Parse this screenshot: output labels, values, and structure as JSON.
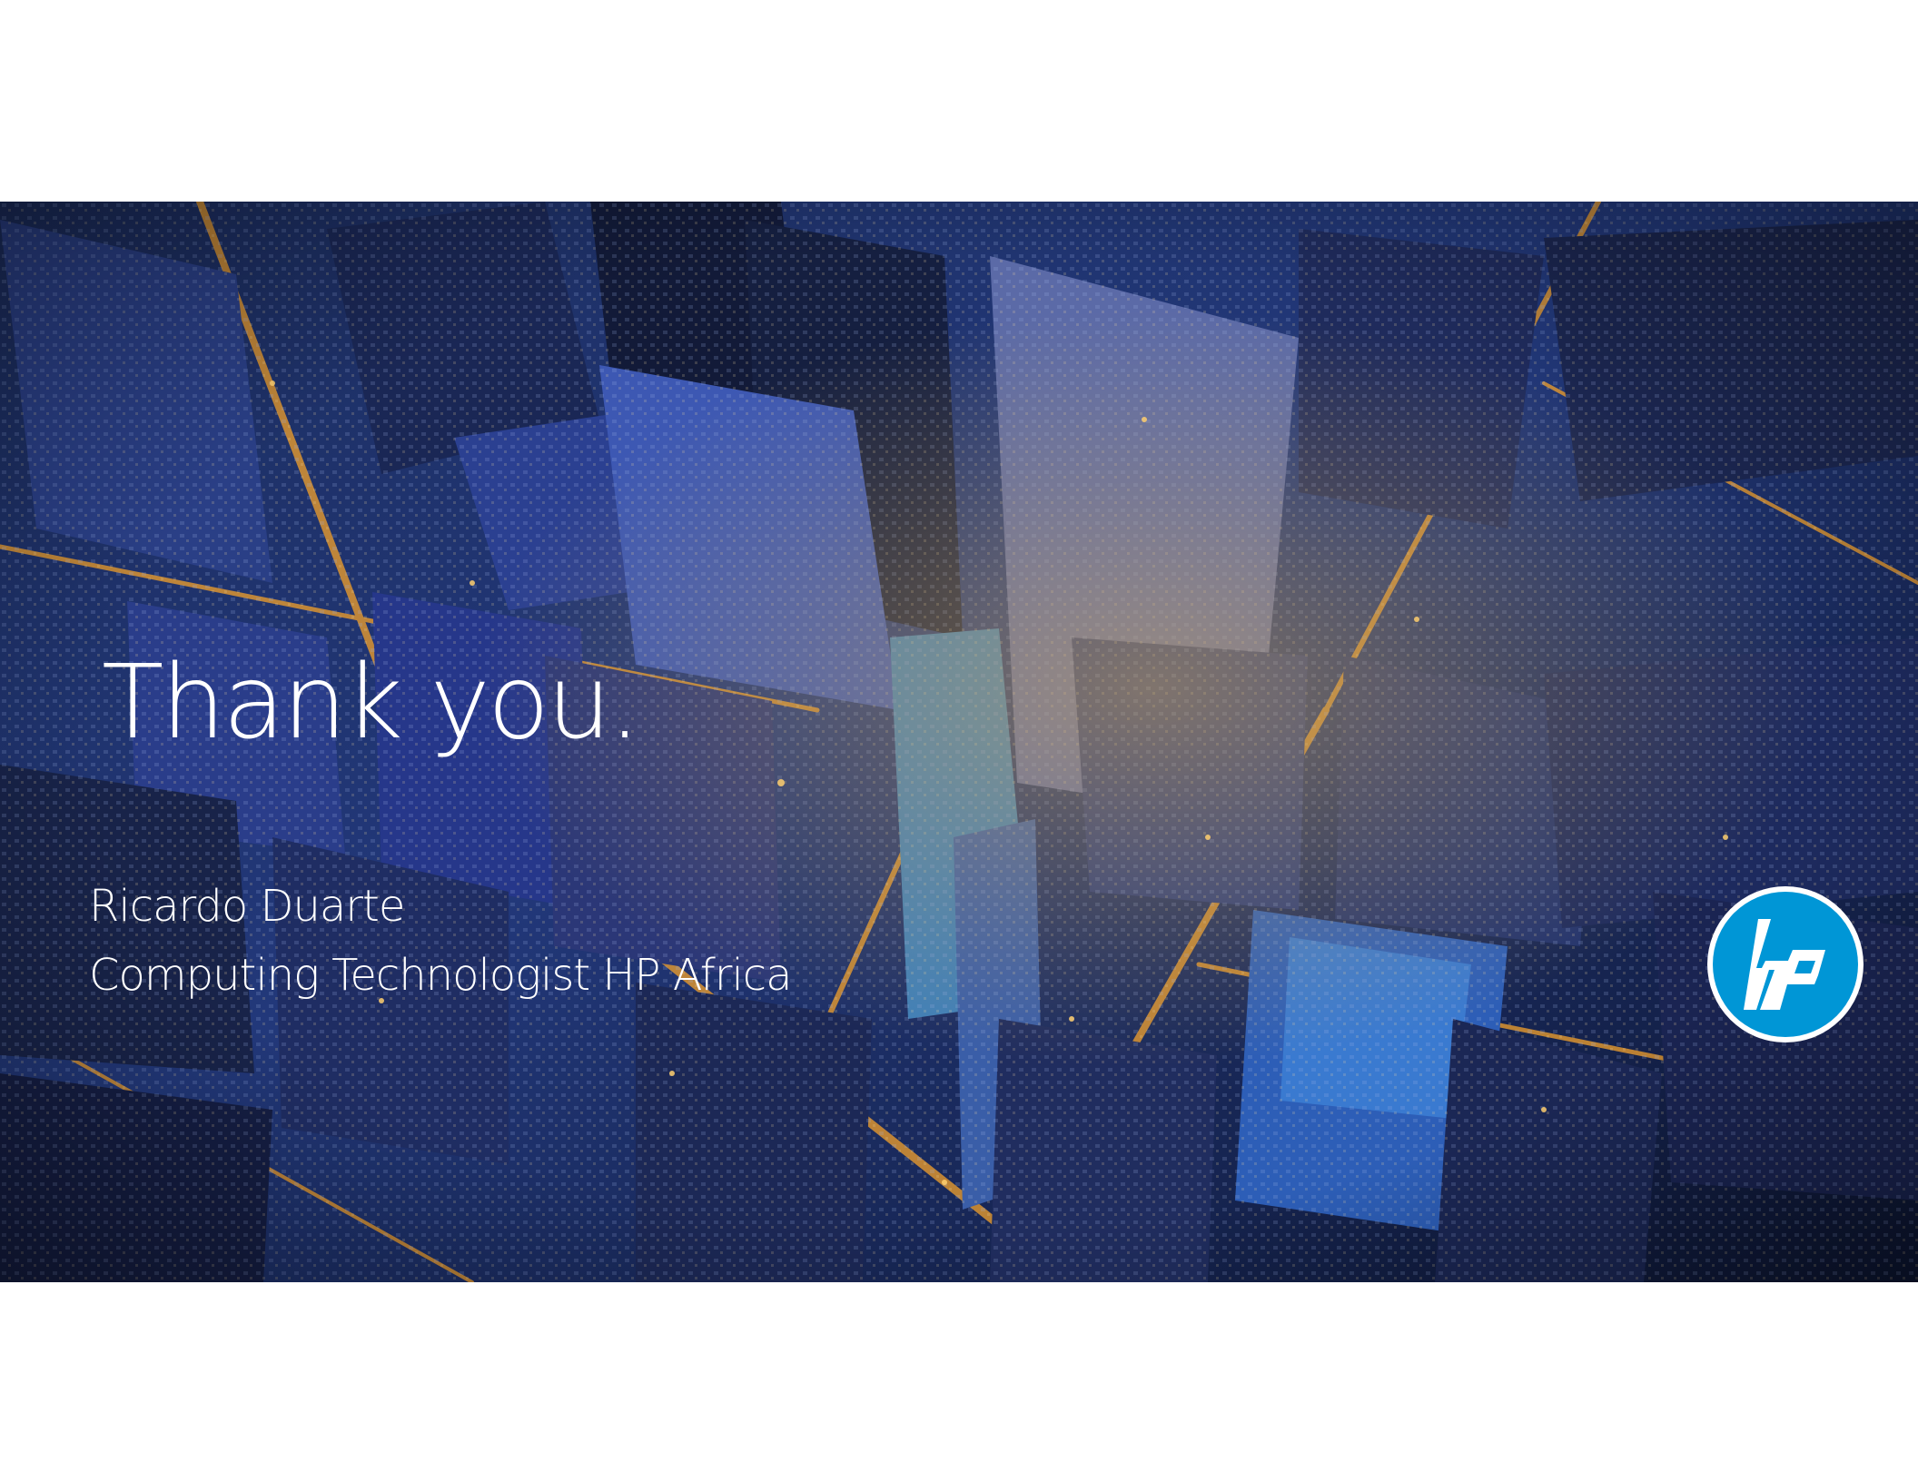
{
  "slide": {
    "title": "Thank you.",
    "presenter_name": "Ricardo Duarte",
    "presenter_role": "Computing Technologist  HP Africa",
    "logo_text": "hp",
    "logo_icon": "hp-logo-icon",
    "background_image": "aerial-city-night-photo"
  },
  "colors": {
    "page_background": "#ffffff",
    "text": "#ffffff",
    "logo_blue": "#0096d6",
    "night_blue": "#0b1a3a",
    "city_lights": "#f0a030"
  }
}
